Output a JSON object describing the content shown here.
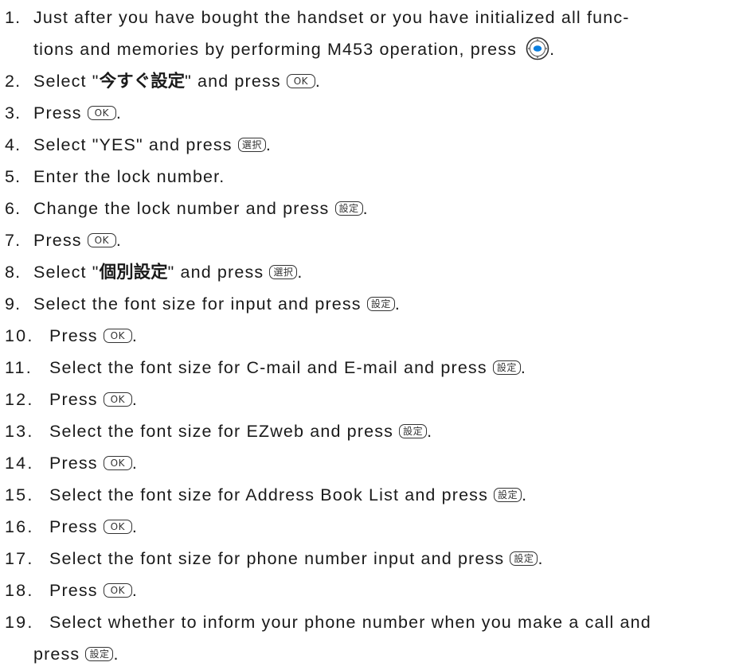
{
  "steps": [
    {
      "n": "1.",
      "line1": "Just after you have bought the handset or you have initialized all func-",
      "line2": "tions and memories by performing M453 operation, press",
      "end": "."
    },
    {
      "n": "2.",
      "a": "Select \"",
      "jp": "今すぐ設定",
      "b": "\" and press",
      "key": "OK",
      "end": "."
    },
    {
      "n": "3.",
      "a": "Press",
      "key": "OK",
      "end": "."
    },
    {
      "n": "4.",
      "a": "Select \"YES\" and press",
      "key": "選択",
      "end": "."
    },
    {
      "n": "5.",
      "a": "Enter the lock number."
    },
    {
      "n": "6.",
      "a": "Change the lock number and press",
      "key": "設定",
      "end": "."
    },
    {
      "n": "7.",
      "a": "Press",
      "key": "OK",
      "end": "."
    },
    {
      "n": "8.",
      "a": "Select \"",
      "jp": "個別設定",
      "b": "\" and press",
      "key": "選択",
      "end": "."
    },
    {
      "n": "9.",
      "a": "Select the font size for input and press",
      "key": "設定",
      "end": "."
    },
    {
      "n": "10.",
      "a": "Press",
      "key": "OK",
      "end": "."
    },
    {
      "n": "11.",
      "a": "Select the font size for C-mail and E-mail and press",
      "key": "設定",
      "end": "."
    },
    {
      "n": "12.",
      "a": "Press",
      "key": "OK",
      "end": "."
    },
    {
      "n": "13.",
      "a": "Select the font size for EZweb and press",
      "key": "設定",
      "end": "."
    },
    {
      "n": "14.",
      "a": "Press",
      "key": "OK",
      "end": "."
    },
    {
      "n": "15.",
      "a": "Select the font size for Address Book List and press",
      "key": "設定",
      "end": "."
    },
    {
      "n": "16.",
      "a": "Press",
      "key": "OK",
      "end": "."
    },
    {
      "n": "17.",
      "a": "Select the font size for phone number input and press",
      "key": "設定",
      "end": "."
    },
    {
      "n": "18.",
      "a": "Press",
      "key": "OK",
      "end": "."
    },
    {
      "n": "19.",
      "line1": "Select whether to inform your phone number when you make a call and",
      "line2": "press",
      "key": "設定",
      "end": "."
    }
  ],
  "icons": {
    "navigation_key": "joystick-center-icon"
  },
  "colors": {
    "text": "#1a1a1a",
    "key_border": "#333333",
    "joy_center": "#0a7fe0"
  }
}
